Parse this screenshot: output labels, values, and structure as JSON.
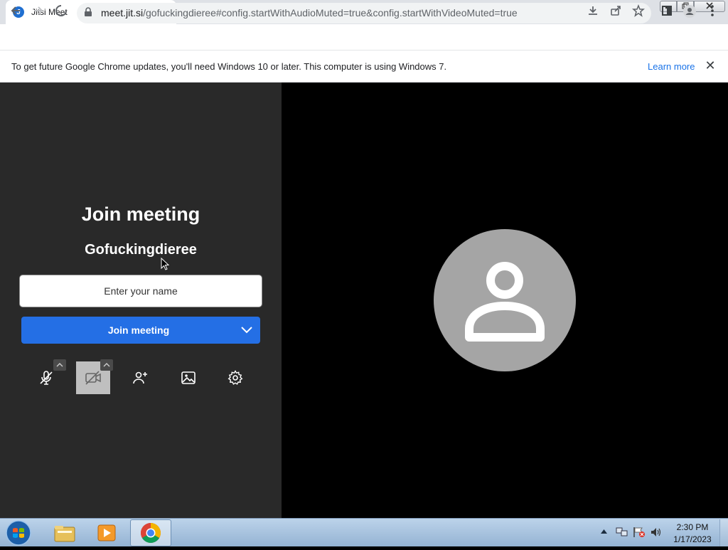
{
  "browser": {
    "tab_title": "Jitsi Meet",
    "favicon_glyph": "J",
    "url_host": "meet.jit.si",
    "url_path": "/gofuckingdieree#config.startWithAudioMuted=true&config.startWithVideoMuted=true",
    "new_tab_label": "+",
    "tab_close_label": "✕"
  },
  "infobar": {
    "message": "To get future Google Chrome updates, you'll need Windows 10 or later. This computer is using Windows 7.",
    "link_label": "Learn more",
    "close_label": "✕"
  },
  "prejoin": {
    "title": "Join meeting",
    "room_name": "Gofuckingdieree",
    "name_placeholder": "Enter your name",
    "join_button_label": "Join meeting",
    "accent_color": "#246fe5",
    "panel_color": "#292929",
    "controls": [
      {
        "name": "microphone",
        "icon": "mic-muted-icon",
        "state": "muted"
      },
      {
        "name": "camera",
        "icon": "camera-off-icon",
        "state": "off"
      },
      {
        "name": "invite",
        "icon": "add-person-icon"
      },
      {
        "name": "background",
        "icon": "image-icon"
      },
      {
        "name": "settings",
        "icon": "gear-icon"
      }
    ]
  },
  "video": {
    "avatar_color": "#a5a5a5",
    "avatar_icon": "person-icon"
  },
  "taskbar": {
    "time": "2:30 PM",
    "date": "1/17/2023",
    "items": [
      "windows-explorer",
      "media-player",
      "google-chrome"
    ]
  }
}
